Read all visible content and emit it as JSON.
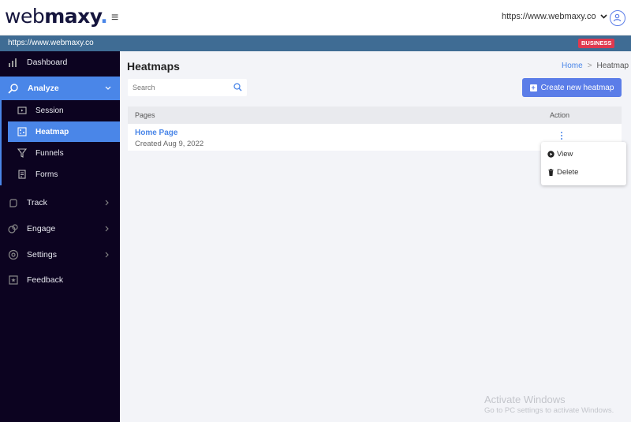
{
  "header": {
    "logo_web": "web",
    "logo_maxy": "maxy",
    "logo_dot": ".",
    "hamburger": "≡",
    "site_url": "https://www.webmaxy.co"
  },
  "subbar": {
    "url": "https://www.webmaxy.co",
    "badge": "BUSINESS"
  },
  "sidebar": {
    "items": [
      {
        "label": "Dashboard",
        "icon": "bar-chart-icon"
      },
      {
        "label": "Analyze",
        "icon": "analyze-icon"
      },
      {
        "label": "Track",
        "icon": "track-icon"
      },
      {
        "label": "Engage",
        "icon": "engage-icon"
      },
      {
        "label": "Settings",
        "icon": "settings-icon"
      },
      {
        "label": "Feedback",
        "icon": "feedback-icon"
      }
    ],
    "subitems": [
      {
        "label": "Session",
        "icon": "session-icon"
      },
      {
        "label": "Heatmap",
        "icon": "heatmap-icon"
      },
      {
        "label": "Funnels",
        "icon": "funnel-icon"
      },
      {
        "label": "Forms",
        "icon": "form-icon"
      }
    ]
  },
  "main": {
    "title": "Heatmaps",
    "breadcrumb": {
      "home": "Home",
      "sep": ">",
      "current": "Heatmap"
    },
    "search_placeholder": "Search",
    "create_button": "Create new heatmap",
    "table": {
      "columns": [
        "Pages",
        "Action"
      ],
      "rows": [
        {
          "name": "Home Page",
          "created": "Created Aug 9, 2022"
        }
      ]
    },
    "menu": {
      "view": "View",
      "delete": "Delete"
    }
  },
  "watermark": {
    "line1": "Activate Windows",
    "line2": "Go to PC settings to activate Windows."
  },
  "colors": {
    "accent": "#4a86e8",
    "sidebar_bg": "#0c0320",
    "subbar_bg": "#3f6c94",
    "badge_bg": "#e0394f"
  }
}
